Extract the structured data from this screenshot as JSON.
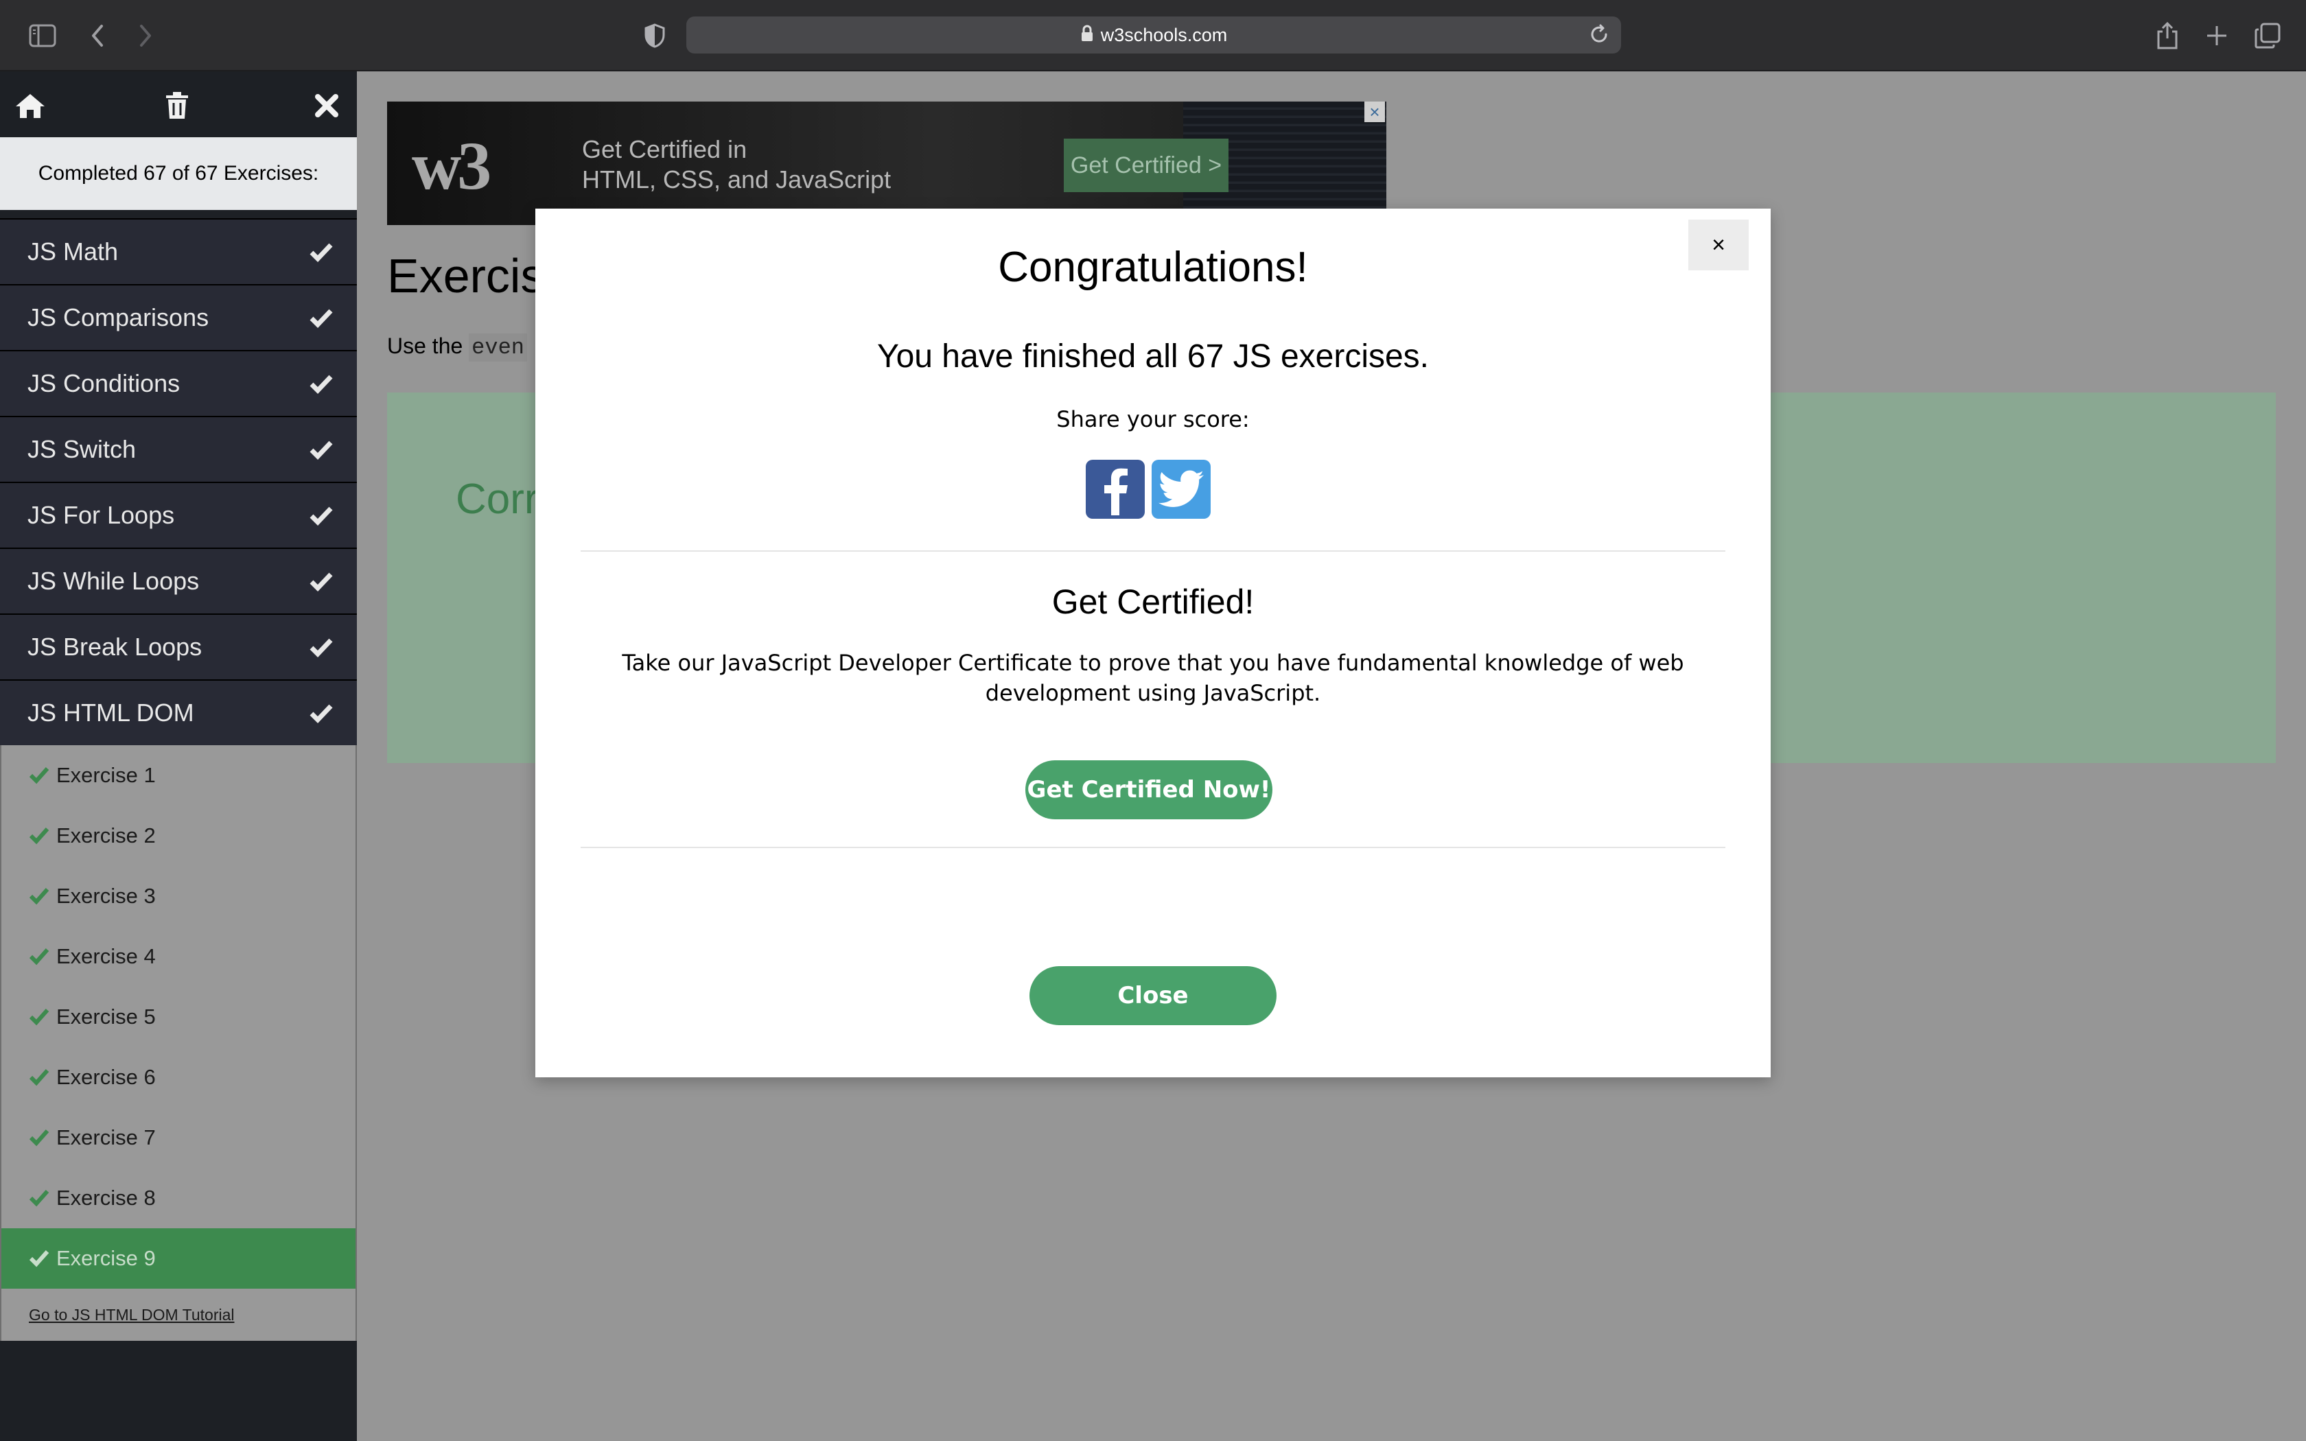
{
  "browser": {
    "url": "w3schools.com"
  },
  "sidebar": {
    "completed_text": "Completed 67 of 67 Exercises:",
    "categories": [
      {
        "label": "JS Math"
      },
      {
        "label": "JS Comparisons"
      },
      {
        "label": "JS Conditions"
      },
      {
        "label": "JS Switch"
      },
      {
        "label": "JS For Loops"
      },
      {
        "label": "JS While Loops"
      },
      {
        "label": "JS Break Loops"
      },
      {
        "label": "JS HTML DOM"
      }
    ],
    "exercises": [
      {
        "label": "Exercise 1"
      },
      {
        "label": "Exercise 2"
      },
      {
        "label": "Exercise 3"
      },
      {
        "label": "Exercise 4"
      },
      {
        "label": "Exercise 5"
      },
      {
        "label": "Exercise 6"
      },
      {
        "label": "Exercise 7"
      },
      {
        "label": "Exercise 8"
      },
      {
        "label": "Exercise 9"
      }
    ],
    "active_exercise": "Exercise 9",
    "tutorial_link": "Go to JS HTML DOM Tutorial"
  },
  "ad": {
    "line1": "Get Certified in",
    "line2": "HTML, CSS, and JavaScript",
    "cta": "Get Certified >"
  },
  "page": {
    "title_partial": "Exercis",
    "instruction_prefix": "Use the",
    "instruction_code_partial": "even",
    "correct_partial": "Corr"
  },
  "modal": {
    "close_symbol": "×",
    "title": "Congratulations!",
    "finished": "You have finished all 67 JS exercises.",
    "share": "Share your score:",
    "cert_heading": "Get Certified!",
    "cert_description": "Take our JavaScript Developer Certificate to prove that you have fundamental knowledge of web development using JavaScript.",
    "cert_button": "Get Certified Now!",
    "close_button": "Close"
  },
  "colors": {
    "accent_green": "#49a26b",
    "sidebar_dark": "#282a35",
    "facebook": "#3b5998",
    "twitter": "#479fe3"
  }
}
